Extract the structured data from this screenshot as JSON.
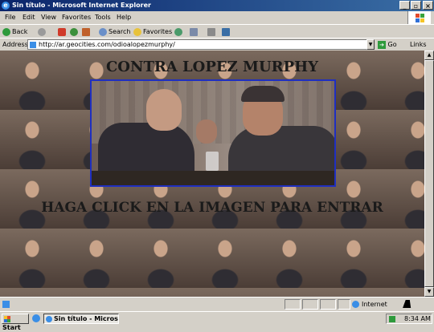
{
  "window": {
    "title": "Sin título - Microsoft Internet Explorer",
    "minimize_glyph": "_",
    "maximize_glyph": "▫",
    "close_glyph": "×",
    "app_icon": "ie-icon"
  },
  "menu": {
    "file": "File",
    "edit": "Edit",
    "view": "View",
    "favorites": "Favorites",
    "tools": "Tools",
    "help": "Help"
  },
  "toolbar": {
    "back": "Back",
    "search": "Search",
    "favorites": "Favorites"
  },
  "address": {
    "label": "Address",
    "url": "http://ar.geocities.com/odioalopezmurphy/",
    "go": "Go",
    "links": "Links"
  },
  "page": {
    "heading_top": "CONTRA LOPEZ MURPHY",
    "heading_bottom": "HAGA CLICK EN LA IMAGEN PARA ENTRAR"
  },
  "status": {
    "zone": "Internet"
  },
  "taskbar": {
    "start": "Start",
    "task": "Sin título - Microsoft I...",
    "clock": "8:34 AM"
  },
  "colors": {
    "title_bar": "#0a246a",
    "chrome": "#d4d0c8",
    "photo_border": "#1f2fc0",
    "go_green": "#2e9a3c"
  }
}
